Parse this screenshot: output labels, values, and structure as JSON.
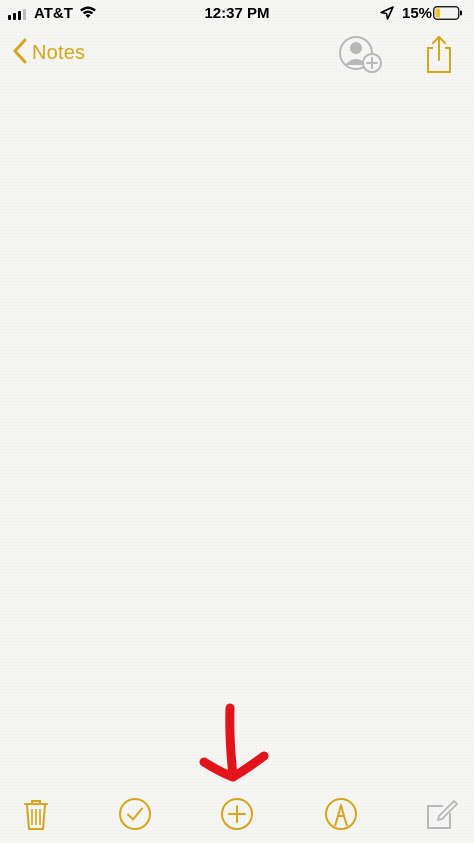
{
  "status_bar": {
    "carrier": "AT&T",
    "time": "12:37 PM",
    "battery_percent": "15%",
    "icons": [
      "signal-icon",
      "wifi-icon",
      "location-arrow-icon",
      "battery-icon"
    ]
  },
  "nav": {
    "back_label": "Notes",
    "back_icon": "chevron-left-icon",
    "add_people_icon": "add-people-icon",
    "share_icon": "share-icon"
  },
  "toolbar": {
    "items": [
      {
        "icon": "trash-icon"
      },
      {
        "icon": "checklist-icon"
      },
      {
        "icon": "plus-circle-icon"
      },
      {
        "icon": "markup-pen-icon"
      },
      {
        "icon": "compose-icon"
      }
    ]
  },
  "colors": {
    "accent": "#d6a51b",
    "background": "#f6f6f4",
    "annotation": "#e3131b",
    "disabled": "#b8b8b8"
  }
}
